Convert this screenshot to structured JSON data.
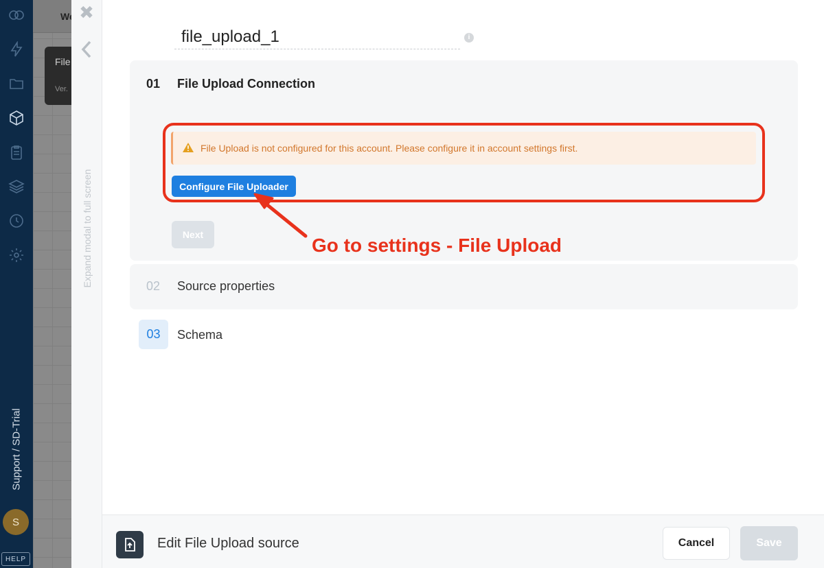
{
  "app": {
    "workspace": "Support / SD-Trial",
    "avatar_initial": "S",
    "help_label": "HELP",
    "nav_icons": [
      "logo-icon",
      "bolt-icon",
      "folder-icon",
      "cube-icon",
      "clipboard-icon",
      "layers-icon",
      "history-icon",
      "gear-icon"
    ]
  },
  "background": {
    "top_tab_fragment": "We",
    "card_title_fragment": "File",
    "card_subtitle_fragment": "Ver."
  },
  "modal": {
    "expand_label": "Expand modal to full screen",
    "source_name": "file_upload_1",
    "info_glyph": "i",
    "steps": [
      {
        "number": "01",
        "title": "File Upload Connection",
        "state": "active"
      },
      {
        "number": "02",
        "title": "Source properties",
        "state": "disabled"
      },
      {
        "number": "03",
        "title": "Schema",
        "state": "pending"
      }
    ],
    "alert": {
      "text": "File Upload is not configured for this account. Please configure it in account settings first.",
      "color": "#d2772c"
    },
    "configure_button": "Configure File Uploader",
    "next_button": "Next",
    "annotation": "Go to settings - File Upload",
    "footer": {
      "title": "Edit File Upload source",
      "cancel_button": "Cancel",
      "save_button": "Save"
    }
  },
  "colors": {
    "sidebar_bg": "#0d2a47",
    "accent": "#1e7fe0",
    "annotation": "#e8321c"
  }
}
